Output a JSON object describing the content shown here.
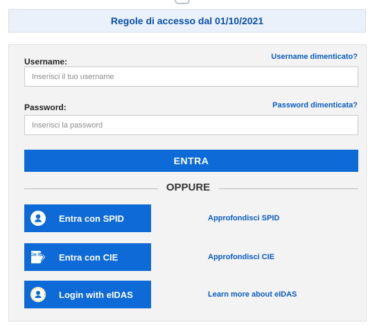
{
  "banner": {
    "link": "Regole di accesso dal 01/10/2021"
  },
  "username": {
    "label": "Username:",
    "forgot": "Username dimenticato?",
    "placeholder": "Inserisci il tuo username"
  },
  "password": {
    "label": "Password:",
    "forgot": "Password dimenticata?",
    "placeholder": "Inserisci la password"
  },
  "enter_button": "ENTRA",
  "separator": "OPPURE",
  "auth_methods": [
    {
      "label": "Entra con SPID",
      "learn": "Approfondisci SPID",
      "icon": "spid-user-icon"
    },
    {
      "label": "Entra con CIE",
      "learn": "Approfondisci CIE",
      "icon": "cie-id-card-icon",
      "icon_text": "Cie ID"
    },
    {
      "label": "Login with eIDAS",
      "learn": "Learn more about eIDAS",
      "icon": "eidas-user-icon"
    }
  ],
  "colors": {
    "primary": "#0d6ad6",
    "link": "#0a5bbf",
    "panel": "#f3f3f3",
    "banner": "#eaf1fa"
  }
}
